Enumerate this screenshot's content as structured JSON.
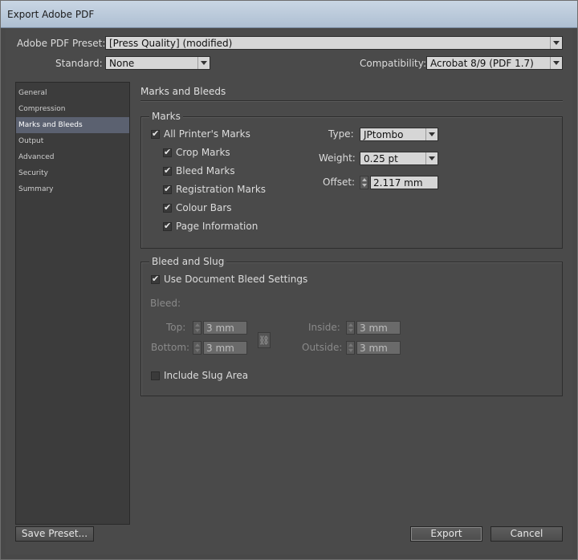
{
  "window": {
    "title": "Export Adobe PDF"
  },
  "preset": {
    "label": "Adobe PDF Preset:",
    "value": "[Press Quality] (modified)"
  },
  "standard": {
    "label": "Standard:",
    "value": "None"
  },
  "compatibility": {
    "label": "Compatibility:",
    "value": "Acrobat 8/9 (PDF 1.7)"
  },
  "sidebar": {
    "items": [
      {
        "label": "General"
      },
      {
        "label": "Compression"
      },
      {
        "label": "Marks and Bleeds"
      },
      {
        "label": "Output"
      },
      {
        "label": "Advanced"
      },
      {
        "label": "Security"
      },
      {
        "label": "Summary"
      }
    ],
    "active_index": 2
  },
  "panel": {
    "title": "Marks and Bleeds"
  },
  "marks": {
    "title": "Marks",
    "all_printers_marks": {
      "label": "All Printer's Marks",
      "checked": true
    },
    "crop_marks": {
      "label": "Crop Marks",
      "checked": true
    },
    "bleed_marks": {
      "label": "Bleed Marks",
      "checked": true
    },
    "registration_marks": {
      "label": "Registration Marks",
      "checked": true
    },
    "colour_bars": {
      "label": "Colour Bars",
      "checked": true
    },
    "page_information": {
      "label": "Page Information",
      "checked": true
    },
    "type": {
      "label": "Type:",
      "value": "JPtombo"
    },
    "weight": {
      "label": "Weight:",
      "value": "0.25 pt"
    },
    "offset": {
      "label": "Offset:",
      "value": "2.117 mm"
    }
  },
  "bleed_slug": {
    "title": "Bleed and Slug",
    "use_document_bleed": {
      "label": "Use Document Bleed Settings",
      "checked": true
    },
    "bleed_label": "Bleed:",
    "top": {
      "label": "Top:",
      "value": "3 mm"
    },
    "bottom": {
      "label": "Bottom:",
      "value": "3 mm"
    },
    "inside": {
      "label": "Inside:",
      "value": "3 mm"
    },
    "outside": {
      "label": "Outside:",
      "value": "3 mm"
    },
    "include_slug": {
      "label": "Include Slug Area",
      "checked": false
    }
  },
  "buttons": {
    "save_preset": "Save Preset...",
    "export": "Export",
    "cancel": "Cancel"
  }
}
